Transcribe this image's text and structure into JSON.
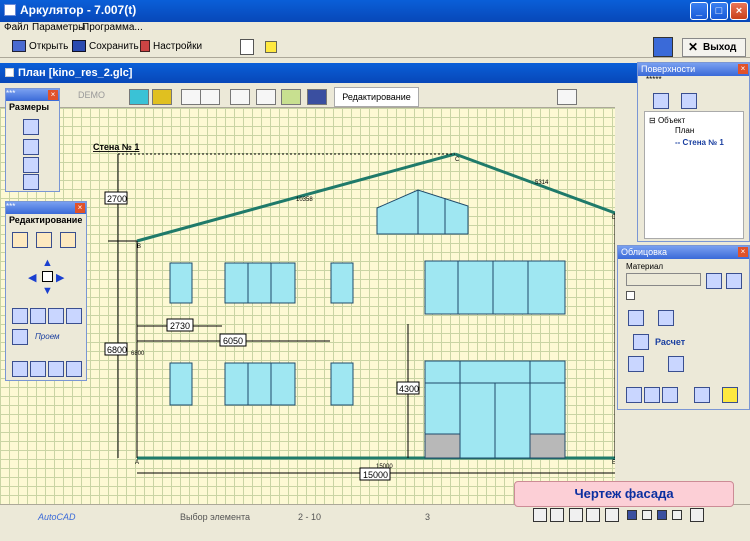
{
  "app": {
    "title": "Аркулятор - 7.007(t)",
    "menu": [
      "Файл",
      "Параметры",
      "Программа..."
    ],
    "toolbar": {
      "open_label": "Открыть",
      "save_label": "Сохранить",
      "settings_label": "Настройки",
      "exit_label": "Выход"
    }
  },
  "document": {
    "title": "План [kino_res_2.glc]",
    "demo_label": "DEMO",
    "mode_label": "Редактирование"
  },
  "drawing": {
    "wall_label": "Стена № 1",
    "dims": {
      "height_top": "2700",
      "height_total": "6800",
      "height_side": "6800",
      "width_left_window": "2730",
      "width_mid": "6050",
      "door_height": "4300",
      "total_width": "15000",
      "total_width_small": "15000",
      "roof_left": "10358",
      "roof_right": "5314"
    },
    "points": {
      "a": "A",
      "b": "B",
      "c": "C",
      "d": "D",
      "e": "E"
    }
  },
  "panels": {
    "sizes": {
      "title": "Размеры"
    },
    "editing": {
      "title": "Редактирование",
      "opening_label": "Проем"
    },
    "surfaces": {
      "title": "Поверхности",
      "dots": "*****",
      "tree": [
        "Объект",
        "План",
        "-- Стена № 1"
      ]
    },
    "cladding": {
      "title": "Облицовка",
      "material_label": "Материал",
      "calc_label": "Расчет"
    }
  },
  "status": {
    "autocad": "AutoCAD",
    "select": "Выбор элемента",
    "range": "2 - 10",
    "count": "3",
    "facade_button": "Чертеж фасада"
  },
  "colors": {
    "titlebar": "#0a5fd8",
    "wall_line": "#1f7a6a",
    "window_fill": "#9fe7f2",
    "canvas_bg": "#fdf9d4",
    "facade_btn_bg": "#fccfd6"
  }
}
